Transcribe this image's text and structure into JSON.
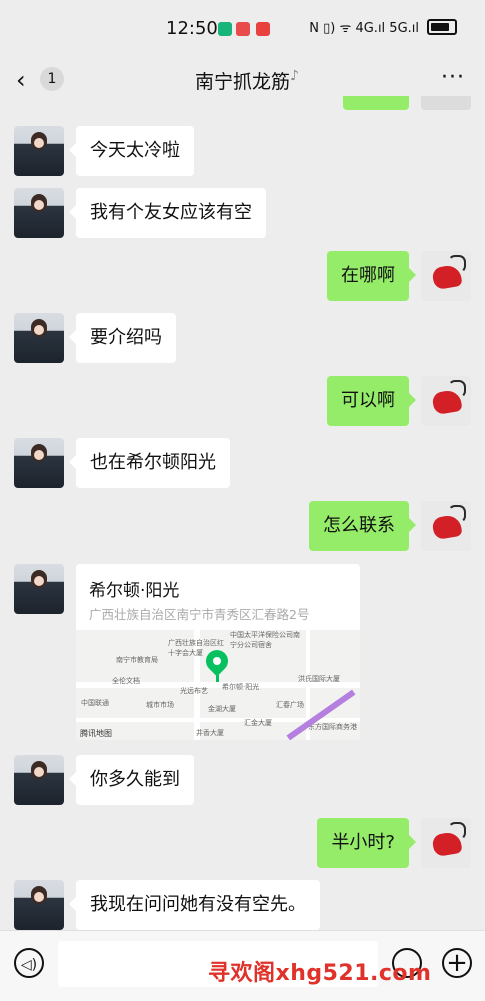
{
  "status": {
    "time": "12:50",
    "right_text": "N  ▯)  ᯤ  4G.ıl  5G.ıl"
  },
  "header": {
    "back_icon": "‹",
    "unread_count": "1",
    "title": "南宁抓龙筋",
    "more_icon": "···"
  },
  "messages": [
    {
      "side": "in",
      "text": "今天太冷啦"
    },
    {
      "side": "in",
      "text": "我有个友女应该有空"
    },
    {
      "side": "out",
      "text": "在哪啊"
    },
    {
      "side": "in",
      "text": "要介绍吗"
    },
    {
      "side": "out",
      "text": "可以啊"
    },
    {
      "side": "in",
      "text": "也在希尔顿阳光"
    },
    {
      "side": "out",
      "text": "怎么联系"
    },
    {
      "side": "in",
      "text": "你多久能到"
    },
    {
      "side": "out",
      "text": "半小时?"
    },
    {
      "side": "in",
      "text": "我现在问问她有没有空先。"
    }
  ],
  "location": {
    "name": "希尔顿·阳光",
    "address": "广西壮族自治区南宁市青秀区汇春路2号",
    "map_labels": [
      "南宁市教育局",
      "广西壮族自治区红十字会大厦",
      "中国太平洋保险公司南宁分公司宿舍",
      "全伦文档",
      "中国联通",
      "城市市场",
      "光远布艺",
      "希尔顿·阳光",
      "金湖大厦",
      "洪氏国际大厦",
      "汇春广场",
      "汇金大厦",
      "东方国际商务港",
      "腾讯地图",
      "井香大厦"
    ]
  },
  "watermark": "寻欢阁xhg521.com",
  "bottombar": {
    "voice_icon": "◁)",
    "plus_icon": "+"
  }
}
